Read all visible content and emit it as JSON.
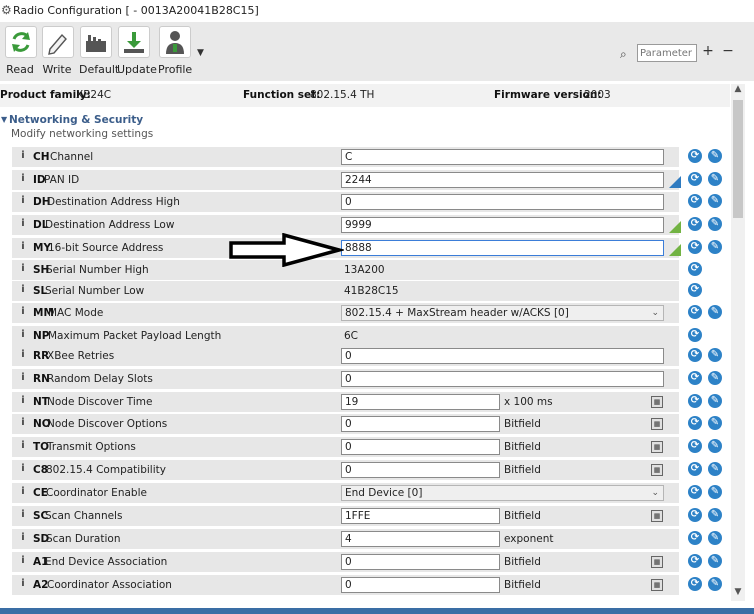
{
  "window": {
    "title": "Radio Configuration [  - 0013A20041B28C15]"
  },
  "toolbar": {
    "buttons": [
      {
        "label": "Read"
      },
      {
        "label": "Write"
      },
      {
        "label": "Default"
      },
      {
        "label": "Update"
      },
      {
        "label": "Profile"
      }
    ],
    "search_placeholder": "Parameter",
    "plus_label": "+",
    "minus_label": "−"
  },
  "info": {
    "product_family_label": "Product family:",
    "product_family_value": "XB24C",
    "function_set_label": "Function set:",
    "function_set_value": "802.15.4 TH",
    "firmware_label": "Firmware version:",
    "firmware_value": "2003"
  },
  "section": {
    "title": "Networking & Security",
    "subtitle": "Modify networking settings"
  },
  "rows": [
    {
      "code": "CH",
      "name": "Channel",
      "kind": "input",
      "value": "C"
    },
    {
      "code": "ID",
      "name": "PAN ID",
      "kind": "input",
      "value": "2244"
    },
    {
      "code": "DH",
      "name": "Destination Address High",
      "kind": "input",
      "value": "0"
    },
    {
      "code": "DL",
      "name": "Destination Address Low",
      "kind": "input",
      "value": "9999"
    },
    {
      "code": "MY",
      "name": "16-bit Source Address",
      "kind": "input",
      "value": "8888"
    },
    {
      "code": "SH",
      "name": "Serial Number High",
      "kind": "readonly",
      "value": "13A200"
    },
    {
      "code": "SL",
      "name": "Serial Number Low",
      "kind": "readonly",
      "value": "41B28C15"
    },
    {
      "code": "MM",
      "name": "MAC Mode",
      "kind": "select",
      "value": "802.15.4 + MaxStream header w/ACKS [0]"
    },
    {
      "code": "NP",
      "name": "Maximum Packet Payload Length",
      "kind": "readonly",
      "value": "6C"
    },
    {
      "code": "RR",
      "name": "XBee Retries",
      "kind": "input",
      "value": "0"
    },
    {
      "code": "RN",
      "name": "Random Delay Slots",
      "kind": "input",
      "value": "0"
    },
    {
      "code": "NT",
      "name": "Node Discover Time",
      "kind": "input-short",
      "value": "19",
      "suffix": "x 100 ms"
    },
    {
      "code": "NO",
      "name": "Node Discover Options",
      "kind": "input-short",
      "value": "0",
      "suffix": "Bitfield"
    },
    {
      "code": "TO",
      "name": "Transmit Options",
      "kind": "input-short",
      "value": "0",
      "suffix": "Bitfield"
    },
    {
      "code": "C8",
      "name": "802.15.4 Compatibility",
      "kind": "input-short",
      "value": "0",
      "suffix": "Bitfield"
    },
    {
      "code": "CE",
      "name": "Coordinator Enable",
      "kind": "select",
      "value": "End Device [0]"
    },
    {
      "code": "SC",
      "name": "Scan Channels",
      "kind": "input-short",
      "value": "1FFE",
      "suffix": "Bitfield"
    },
    {
      "code": "SD",
      "name": "Scan Duration",
      "kind": "input-short",
      "value": "4",
      "suffix": "exponent"
    },
    {
      "code": "A1",
      "name": "End Device Association",
      "kind": "input-short",
      "value": "0",
      "suffix": "Bitfield"
    },
    {
      "code": "A2",
      "name": "Coordinator Association",
      "kind": "input-short",
      "value": "0",
      "suffix": "Bitfield"
    }
  ],
  "colors": {
    "accent_blue": "#2d82c7",
    "changed_blue": "#2f7bc0",
    "changed_green": "#72b343",
    "section_blue": "#3b5d8a"
  }
}
